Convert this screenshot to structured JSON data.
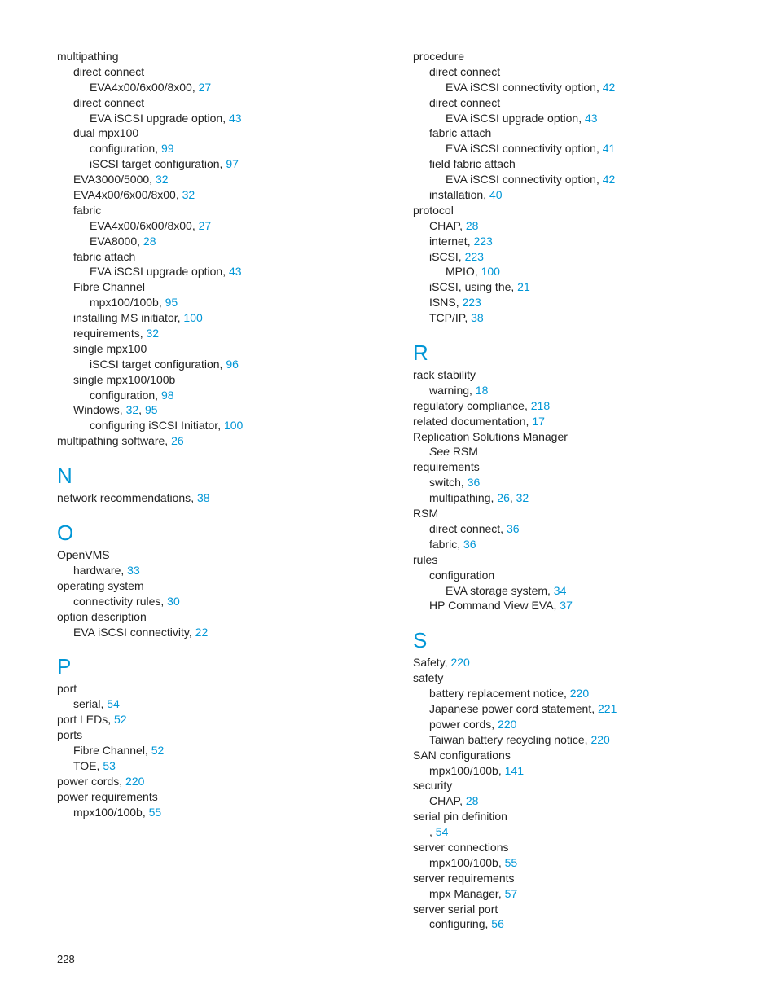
{
  "pageNumber": "228",
  "left": [
    {
      "indent": 0,
      "text": "multipathing"
    },
    {
      "indent": 1,
      "text": "direct connect"
    },
    {
      "indent": 2,
      "text": "EVA4x00/6x00/8x00",
      "pages": [
        "27"
      ]
    },
    {
      "indent": 1,
      "text": "direct connect"
    },
    {
      "indent": 2,
      "text": "EVA iSCSI upgrade option",
      "pages": [
        "43"
      ]
    },
    {
      "indent": 1,
      "text": "dual mpx100"
    },
    {
      "indent": 2,
      "text": "configuration",
      "pages": [
        "99"
      ]
    },
    {
      "indent": 2,
      "text": "iSCSI target configuration",
      "pages": [
        "97"
      ]
    },
    {
      "indent": 1,
      "text": "EVA3000/5000",
      "pages": [
        "32"
      ]
    },
    {
      "indent": 1,
      "text": "EVA4x00/6x00/8x00",
      "pages": [
        "32"
      ]
    },
    {
      "indent": 1,
      "text": "fabric"
    },
    {
      "indent": 2,
      "text": "EVA4x00/6x00/8x00",
      "pages": [
        "27"
      ]
    },
    {
      "indent": 2,
      "text": "EVA8000",
      "pages": [
        "28"
      ]
    },
    {
      "indent": 1,
      "text": "fabric attach"
    },
    {
      "indent": 2,
      "text": "EVA iSCSI upgrade option",
      "pages": [
        "43"
      ]
    },
    {
      "indent": 1,
      "text": "Fibre Channel"
    },
    {
      "indent": 2,
      "text": "mpx100/100b",
      "pages": [
        "95"
      ]
    },
    {
      "indent": 1,
      "text": "installing MS initiator",
      "pages": [
        "100"
      ]
    },
    {
      "indent": 1,
      "text": "requirements",
      "pages": [
        "32"
      ]
    },
    {
      "indent": 1,
      "text": "single mpx100"
    },
    {
      "indent": 2,
      "text": "iSCSI target configuration",
      "pages": [
        "96"
      ]
    },
    {
      "indent": 1,
      "text": "single mpx100/100b"
    },
    {
      "indent": 2,
      "text": "configuration",
      "pages": [
        "98"
      ]
    },
    {
      "indent": 1,
      "text": "Windows",
      "pages": [
        "32",
        "95"
      ]
    },
    {
      "indent": 2,
      "text": "configuring iSCSI Initiator",
      "pages": [
        "100"
      ]
    },
    {
      "indent": 0,
      "text": "multipathing software",
      "pages": [
        "26"
      ]
    },
    {
      "letter": "N"
    },
    {
      "indent": 0,
      "text": "network recommendations",
      "pages": [
        "38"
      ]
    },
    {
      "letter": "O"
    },
    {
      "indent": 0,
      "text": "OpenVMS"
    },
    {
      "indent": 1,
      "text": "hardware",
      "pages": [
        "33"
      ]
    },
    {
      "indent": 0,
      "text": "operating system"
    },
    {
      "indent": 1,
      "text": "connectivity rules",
      "pages": [
        "30"
      ]
    },
    {
      "indent": 0,
      "text": "option description"
    },
    {
      "indent": 1,
      "text": "EVA iSCSI connectivity",
      "pages": [
        "22"
      ]
    },
    {
      "letter": "P"
    },
    {
      "indent": 0,
      "text": "port"
    },
    {
      "indent": 1,
      "text": "serial",
      "pages": [
        "54"
      ]
    },
    {
      "indent": 0,
      "text": "port LEDs",
      "pages": [
        "52"
      ]
    },
    {
      "indent": 0,
      "text": "ports"
    },
    {
      "indent": 1,
      "text": "Fibre Channel",
      "pages": [
        "52"
      ]
    },
    {
      "indent": 1,
      "text": "TOE",
      "pages": [
        "53"
      ]
    },
    {
      "indent": 0,
      "text": "power cords",
      "pages": [
        "220"
      ]
    },
    {
      "indent": 0,
      "text": "power requirements"
    },
    {
      "indent": 1,
      "text": "mpx100/100b",
      "pages": [
        "55"
      ]
    }
  ],
  "right": [
    {
      "indent": 0,
      "text": "procedure"
    },
    {
      "indent": 1,
      "text": "direct connect"
    },
    {
      "indent": 2,
      "text": "EVA iSCSI connectivity option",
      "pages": [
        "42"
      ]
    },
    {
      "indent": 1,
      "text": "direct connect"
    },
    {
      "indent": 2,
      "text": "EVA iSCSI upgrade option",
      "pages": [
        "43"
      ]
    },
    {
      "indent": 1,
      "text": "fabric attach"
    },
    {
      "indent": 2,
      "text": "EVA iSCSI connectivity option",
      "pages": [
        "41"
      ]
    },
    {
      "indent": 1,
      "text": "field fabric attach"
    },
    {
      "indent": 2,
      "text": "EVA iSCSI connectivity option",
      "pages": [
        "42"
      ]
    },
    {
      "indent": 1,
      "text": "installation",
      "pages": [
        "40"
      ]
    },
    {
      "indent": 0,
      "text": "protocol"
    },
    {
      "indent": 1,
      "text": "CHAP",
      "pages": [
        "28"
      ]
    },
    {
      "indent": 1,
      "text": "internet",
      "pages": [
        "223"
      ]
    },
    {
      "indent": 1,
      "text": "iSCSI",
      "pages": [
        "223"
      ]
    },
    {
      "indent": 2,
      "text": "MPIO",
      "pages": [
        "100"
      ]
    },
    {
      "indent": 1,
      "text": "iSCSI, using the",
      "pages": [
        "21"
      ]
    },
    {
      "indent": 1,
      "text": "ISNS",
      "pages": [
        "223"
      ]
    },
    {
      "indent": 1,
      "text": "TCP/IP",
      "pages": [
        "38"
      ]
    },
    {
      "letter": "R"
    },
    {
      "indent": 0,
      "text": "rack stability"
    },
    {
      "indent": 1,
      "text": "warning",
      "pages": [
        "18"
      ]
    },
    {
      "indent": 0,
      "text": "regulatory compliance",
      "pages": [
        "218"
      ]
    },
    {
      "indent": 0,
      "text": "related documentation",
      "pages": [
        "17"
      ]
    },
    {
      "indent": 0,
      "text": "Replication Solutions Manager"
    },
    {
      "indent": 1,
      "see": "See",
      "text": "RSM"
    },
    {
      "indent": 0,
      "text": "requirements"
    },
    {
      "indent": 1,
      "text": "switch",
      "pages": [
        "36"
      ]
    },
    {
      "indent": 1,
      "text": "multipathing",
      "pages": [
        "26",
        "32"
      ]
    },
    {
      "indent": 0,
      "text": "RSM"
    },
    {
      "indent": 1,
      "text": "direct connect",
      "pages": [
        "36"
      ]
    },
    {
      "indent": 1,
      "text": "fabric",
      "pages": [
        "36"
      ]
    },
    {
      "indent": 0,
      "text": "rules"
    },
    {
      "indent": 1,
      "text": "configuration"
    },
    {
      "indent": 2,
      "text": "EVA storage system",
      "pages": [
        "34"
      ]
    },
    {
      "indent": 1,
      "text": "HP Command View EVA",
      "pages": [
        "37"
      ]
    },
    {
      "letter": "S"
    },
    {
      "indent": 0,
      "text": "Safety",
      "pages": [
        "220"
      ]
    },
    {
      "indent": 0,
      "text": "safety"
    },
    {
      "indent": 1,
      "text": "battery replacement notice",
      "pages": [
        "220"
      ]
    },
    {
      "indent": 1,
      "text": "Japanese power cord statement",
      "pages": [
        "221"
      ]
    },
    {
      "indent": 1,
      "text": "power cords",
      "pages": [
        "220"
      ]
    },
    {
      "indent": 1,
      "text": "Taiwan battery recycling notice",
      "pages": [
        "220"
      ]
    },
    {
      "indent": 0,
      "text": "SAN configurations"
    },
    {
      "indent": 1,
      "text": "mpx100/100b",
      "pages": [
        "141"
      ]
    },
    {
      "indent": 0,
      "text": "security"
    },
    {
      "indent": 1,
      "text": "CHAP",
      "pages": [
        "28"
      ]
    },
    {
      "indent": 0,
      "text": "serial pin definition"
    },
    {
      "indent": 1,
      "text": "",
      "pages": [
        "54"
      ]
    },
    {
      "indent": 0,
      "text": "server connections"
    },
    {
      "indent": 1,
      "text": "mpx100/100b",
      "pages": [
        "55"
      ]
    },
    {
      "indent": 0,
      "text": "server requirements"
    },
    {
      "indent": 1,
      "text": "mpx Manager",
      "pages": [
        "57"
      ]
    },
    {
      "indent": 0,
      "text": "server serial port"
    },
    {
      "indent": 1,
      "text": "configuring",
      "pages": [
        "56"
      ]
    }
  ]
}
